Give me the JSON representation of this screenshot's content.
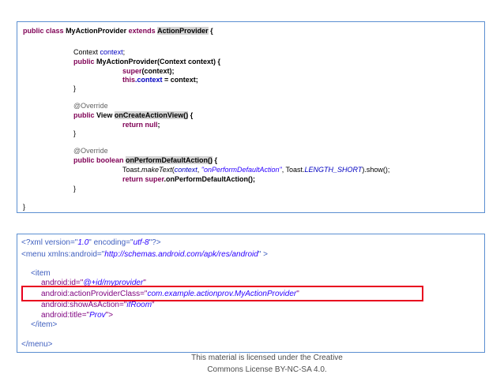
{
  "java_code": {
    "l1": {
      "kw1": "public",
      "kw2": "class",
      "name": "MyActionProvider",
      "kw3": "extends",
      "parent": "ActionProvider",
      "brace": " {"
    },
    "l2": {
      "type": "Context",
      "field": "context",
      "semi": ";"
    },
    "l3": {
      "kw": "public",
      "text": "MyActionProvider(Context context) {"
    },
    "l4": {
      "kw": "super",
      "text": "(context);"
    },
    "l5": {
      "kw": "this",
      "field": ".context",
      "text": " = context;"
    },
    "l6": "}",
    "l7": "@Override",
    "l8": {
      "kw": "public",
      "type": "View",
      "method": "onCreateActionView()",
      "brace": " {"
    },
    "l9": {
      "kw": "return",
      "kw2": "null",
      "semi": ";"
    },
    "l10": "}",
    "l11": "@Override",
    "l12": {
      "kw": "public",
      "kw2": "boolean",
      "method": "onPerformDefaultAction()",
      "brace": " {"
    },
    "l13": {
      "p1": "Toast.",
      "p2": "makeText",
      "p3": "(",
      "p4": "context",
      "p5": ", ",
      "p6": "\"onPerformDefaultAction\"",
      "p7": ", Toast.",
      "p8": "LENGTH_SHORT",
      "p9": ").show();"
    },
    "l14": {
      "kw": "return",
      "kw2": "super",
      "text": ".onPerformDefaultAction();"
    },
    "l15": "}",
    "l16": "}"
  },
  "xml_code": {
    "l1": {
      "a": "<?xml version=\"",
      "b": "1.0",
      "c": "\" encoding=\"",
      "d": "utf-8",
      "e": "\"?>"
    },
    "l2": {
      "a": "<menu xmlns:android=\"",
      "b": "http://schemas.android.com/apk/res/android",
      "c": "\" >"
    },
    "l3": "<item",
    "l4": {
      "a": "android:id=\"",
      "b": "@+id/myprovider",
      "c": "\""
    },
    "l5": {
      "a": "android:actionProviderClass=\"",
      "b": "com.example.actionprov.MyActionProvider",
      "c": "\""
    },
    "l6": {
      "a": "android:showAsAction=\"",
      "b": "ifRoom",
      "c": "\""
    },
    "l7": {
      "a": "android:title=\"",
      "b": "Prov",
      "c": "\">"
    },
    "l8": "</item>",
    "l9": "</menu>"
  },
  "license": {
    "line1": "This material is licensed under the Creative",
    "line2": "Commons License BY-NC-SA 4.0."
  },
  "colors": {
    "highlight_box": "#e8001e",
    "box_border": "#5b8fd1"
  }
}
